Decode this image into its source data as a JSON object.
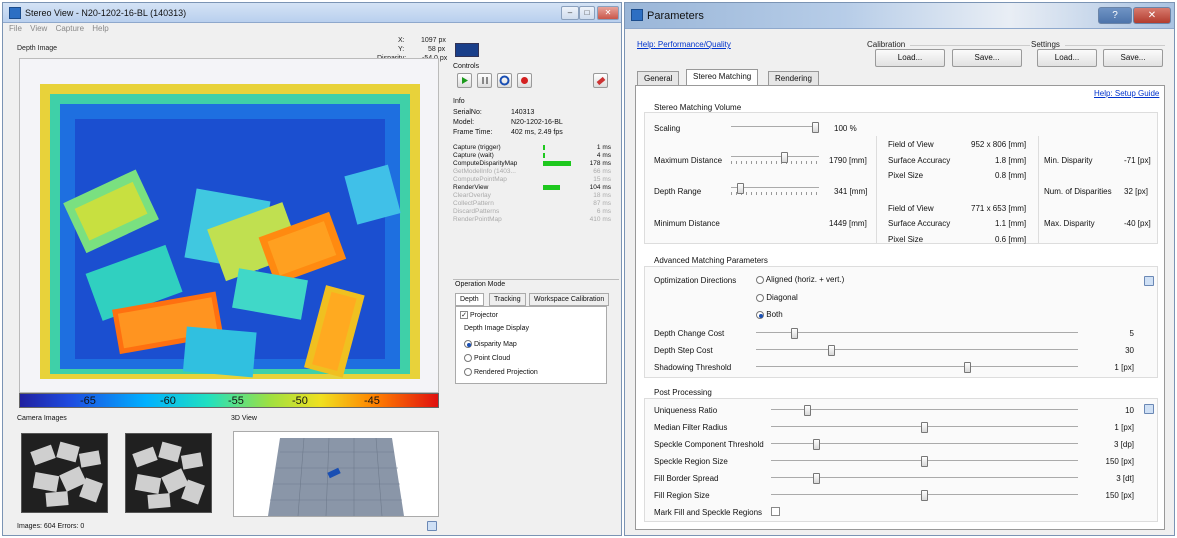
{
  "left_window": {
    "title": "Stereo View - N20-1202-16-BL (140313)",
    "menu": [
      "File",
      "View",
      "Capture",
      "Help"
    ],
    "depth_image_label": "Depth Image",
    "readout": {
      "x_label": "X:",
      "x": "1097 px",
      "y_label": "Y:",
      "y": "58 px",
      "disp_label": "Disparity:",
      "disp": "-54.0 px"
    },
    "colorbar_ticks": [
      "-65",
      "-60",
      "-55",
      "-50",
      "-45"
    ],
    "controls_label": "Controls",
    "info_label": "Info",
    "info": [
      {
        "k": "SerialNo:",
        "v": "140313"
      },
      {
        "k": "Model:",
        "v": "N20-1202-16-BL"
      },
      {
        "k": "Frame Time:",
        "v": "402 ms, 2.49 fps"
      }
    ],
    "timings": [
      {
        "name": "Capture (trigger)",
        "ms": "1 ms",
        "bar": 0.01,
        "dim": false
      },
      {
        "name": "Capture (wait)",
        "ms": "4 ms",
        "bar": 0.02,
        "dim": false
      },
      {
        "name": "ComputeDisparityMap",
        "ms": "178 ms",
        "bar": 1.0,
        "dim": false
      },
      {
        "name": "GetModelInfo (1403...",
        "ms": "66 ms",
        "bar": 0,
        "dim": true
      },
      {
        "name": "ComputePointMap",
        "ms": "15 ms",
        "bar": 0,
        "dim": true
      },
      {
        "name": "RenderView",
        "ms": "104 ms",
        "bar": 0.6,
        "dim": false
      },
      {
        "name": "ClearOverlay",
        "ms": "18 ms",
        "bar": 0,
        "dim": true
      },
      {
        "name": "CollectPattern",
        "ms": "87 ms",
        "bar": 0,
        "dim": true
      },
      {
        "name": "DiscardPatterns",
        "ms": "6 ms",
        "bar": 0,
        "dim": true
      },
      {
        "name": "RenderPointMap",
        "ms": "410 ms",
        "bar": 0,
        "dim": true
      }
    ],
    "operation_mode_label": "Operation Mode",
    "op_tabs": [
      "Depth",
      "Tracking",
      "Workspace Calibration"
    ],
    "projector_label": "Projector",
    "depth_display_label": "Depth Image Display",
    "display_options": [
      {
        "label": "Disparity Map",
        "on": true
      },
      {
        "label": "Point Cloud",
        "on": false
      },
      {
        "label": "Rendered Projection",
        "on": false
      }
    ],
    "camera_images_label": "Camera Images",
    "view3d_label": "3D View",
    "status": "Images: 604  Errors: 0"
  },
  "right_window": {
    "title": "Parameters",
    "help_perf": "Help: Performance/Quality",
    "calibration_label": "Calibration",
    "settings_label": "Settings",
    "load_label": "Load...",
    "save_label": "Save...",
    "tabs": [
      "General",
      "Stereo Matching",
      "Rendering"
    ],
    "active_tab": "Stereo Matching",
    "help_setup": "Help: Setup Guide",
    "volume": {
      "title": "Stereo Matching Volume",
      "scaling_label": "Scaling",
      "scaling_value": "100 %",
      "scaling_level": 1.0,
      "max_dist_label": "Maximum Distance",
      "max_dist_value": "1790 [mm]",
      "max_dist_level": 0.62,
      "depth_range_label": "Depth Range",
      "depth_range_value": "341 [mm]",
      "depth_range_level": 0.08,
      "min_dist_label": "Minimum Distance",
      "min_dist_value": "1449 [mm]",
      "far": {
        "fov_label": "Field of View",
        "fov": "952 x 806 [mm]",
        "acc_label": "Surface Accuracy",
        "acc": "1.8 [mm]",
        "px_label": "Pixel Size",
        "px": "0.8 [mm]"
      },
      "near": {
        "fov_label": "Field of View",
        "fov": "771 x 653 [mm]",
        "acc_label": "Surface Accuracy",
        "acc": "1.1 [mm]",
        "px_label": "Pixel Size",
        "px": "0.6 [mm]"
      },
      "min_disp_label": "Min. Disparity",
      "min_disp": "-71 [px]",
      "num_disp_label": "Num. of Disparities",
      "num_disp": "32 [px]",
      "max_disp_label": "Max. Disparity",
      "max_disp": "-40 [px]"
    },
    "advanced": {
      "title": "Advanced Matching Parameters",
      "opt_label": "Optimization Directions",
      "opt_options": [
        {
          "label": "Aligned (horiz. + vert.)",
          "on": false
        },
        {
          "label": "Diagonal",
          "on": false
        },
        {
          "label": "Both",
          "on": true
        }
      ],
      "rows": [
        {
          "label": "Depth Change Cost",
          "value": "5",
          "level": 0.11
        },
        {
          "label": "Depth Step Cost",
          "value": "30",
          "level": 0.23
        },
        {
          "label": "Shadowing Threshold",
          "value": "1 [px]",
          "level": 0.66
        }
      ]
    },
    "post": {
      "title": "Post Processing",
      "rows": [
        {
          "label": "Uniqueness Ratio",
          "value": "10",
          "level": 0.11
        },
        {
          "label": "Median Filter Radius",
          "value": "1 [px]",
          "level": 0.5
        },
        {
          "label": "Speckle Component Threshold",
          "value": "3 [dp]",
          "level": 0.14
        },
        {
          "label": "Speckle Region Size",
          "value": "150 [px]",
          "level": 0.5
        },
        {
          "label": "Fill Border Spread",
          "value": "3 [dt]",
          "level": 0.14
        },
        {
          "label": "Fill Region Size",
          "value": "150 [px]",
          "level": 0.5
        }
      ],
      "mark_label": "Mark Fill and Speckle Regions"
    }
  }
}
